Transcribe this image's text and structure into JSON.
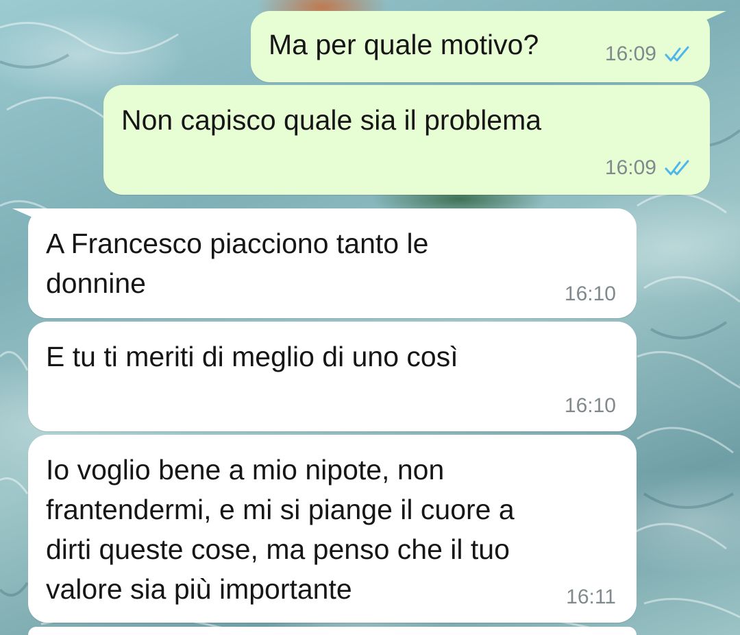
{
  "accent": {
    "outgoing_bubble": "#e7fdd3",
    "incoming_bubble": "#ffffff",
    "read_ticks": "#4fb6ec",
    "meta_text": "#808a8d"
  },
  "messages": [
    {
      "direction": "outgoing",
      "text": "Ma per quale motivo?",
      "time": "16:09",
      "status_icon": "double-check-read-icon"
    },
    {
      "direction": "outgoing",
      "text": "Non capisco quale sia il problema",
      "time": "16:09",
      "status_icon": "double-check-read-icon"
    },
    {
      "direction": "incoming",
      "text": "A Francesco piacciono tanto le\ndonnine",
      "time": "16:10"
    },
    {
      "direction": "incoming",
      "text": "E tu ti meriti di meglio di uno così",
      "time": "16:10"
    },
    {
      "direction": "incoming",
      "text": "Io voglio bene a mio nipote, non\nfrantendermi, e mi si piange il cuore a\ndirti queste cose, ma penso che il tuo\nvalore sia più importante",
      "time": "16:11"
    }
  ]
}
